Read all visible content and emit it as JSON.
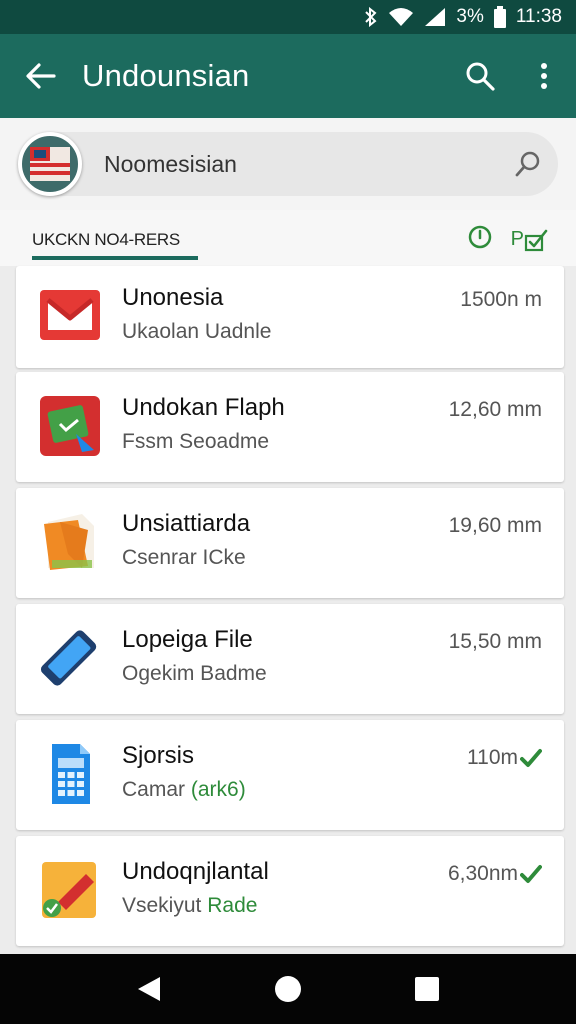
{
  "status_bar": {
    "battery": "3%",
    "time": "11:38",
    "icons": [
      "bluetooth-icon",
      "wifi-icon",
      "signal-icon",
      "battery-icon"
    ]
  },
  "app_bar": {
    "title": "Undounsian",
    "icons": [
      "back-arrow-icon",
      "search-icon",
      "more-vert-icon"
    ]
  },
  "search": {
    "value": "Noomesisian",
    "avatar_icon": "flag-icon"
  },
  "tabs": {
    "label": "UKCKN NO4-RERS",
    "right_label": "P",
    "icons": [
      "timer-icon",
      "share-check-icon"
    ]
  },
  "items": [
    {
      "name": "Unonesia",
      "subtitle": "Ukaolan Uadnle",
      "subtitle_highlight": "",
      "size": "1500n m",
      "icon": "gmail-icon",
      "verified": false
    },
    {
      "name": "Undokan Flaph",
      "subtitle": "Fssm Seoadme",
      "subtitle_highlight": "",
      "size": "12,60 mm",
      "icon": "flash-app-icon",
      "verified": false
    },
    {
      "name": "Unsiattiarda",
      "subtitle": "Csenrar ICke",
      "subtitle_highlight": "",
      "size": "19,60 mm",
      "icon": "folder-icon",
      "verified": false
    },
    {
      "name": "Lopeiga File",
      "subtitle": "Ogekim Badme",
      "subtitle_highlight": "",
      "size": "15,50 mm",
      "icon": "phone-icon",
      "verified": false
    },
    {
      "name": "Sjorsis",
      "subtitle": "Camar",
      "subtitle_highlight": "(ark6)",
      "size": "110m",
      "icon": "calculator-icon",
      "verified": true
    },
    {
      "name": "Undoqnjlantal",
      "subtitle": "Vsekiyut",
      "subtitle_highlight": "Rade",
      "size": "6,30nm",
      "icon": "document-edit-icon",
      "verified": true
    }
  ],
  "nav": {
    "icons": [
      "nav-back-icon",
      "nav-home-icon",
      "nav-recents-icon"
    ]
  },
  "colors": {
    "app_bar": "#1c6b5e",
    "status_bar": "#0f4a40",
    "accent_green": "#2e8b3a"
  }
}
